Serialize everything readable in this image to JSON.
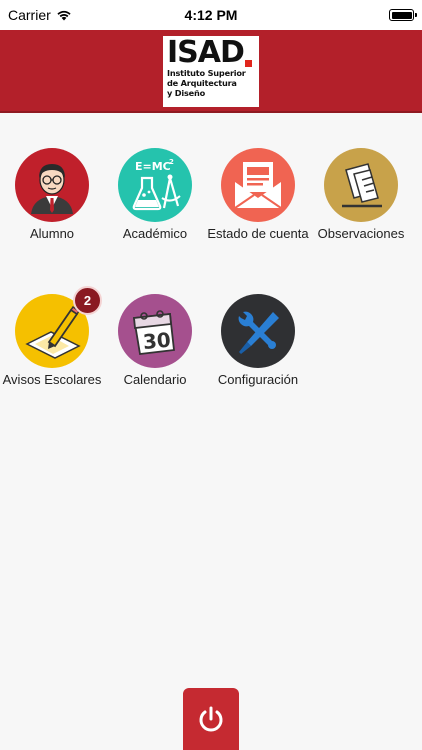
{
  "status_bar": {
    "carrier": "Carrier",
    "time": "4:12 PM"
  },
  "header": {
    "logo_title": "ISAD",
    "logo_line1": "Instituto Superior",
    "logo_line2": "de Arquitectura",
    "logo_line3": "y Diseño"
  },
  "menu": {
    "alumno": {
      "label": "Alumno",
      "icon": "student-icon",
      "color": "#c0202b"
    },
    "academico": {
      "label": "Académico",
      "icon": "science-icon",
      "color": "#25c3ad"
    },
    "estado_cuenta": {
      "label": "Estado de cuenta",
      "icon": "envelope-icon",
      "color": "#f06452"
    },
    "observaciones": {
      "label": "Observaciones",
      "icon": "notes-icon",
      "color": "#c8a24a"
    },
    "avisos": {
      "label": "Avisos Escolares",
      "icon": "pencil-paper-icon",
      "color": "#f5c000",
      "badge": "2"
    },
    "calendario": {
      "label": "Calendario",
      "icon": "calendar-icon",
      "color": "#a5508e",
      "day": "30"
    },
    "configuracion": {
      "label": "Configuración",
      "icon": "tools-icon",
      "color": "#2f3033"
    }
  },
  "power": {
    "icon": "power-icon",
    "color": "#c52a31"
  }
}
